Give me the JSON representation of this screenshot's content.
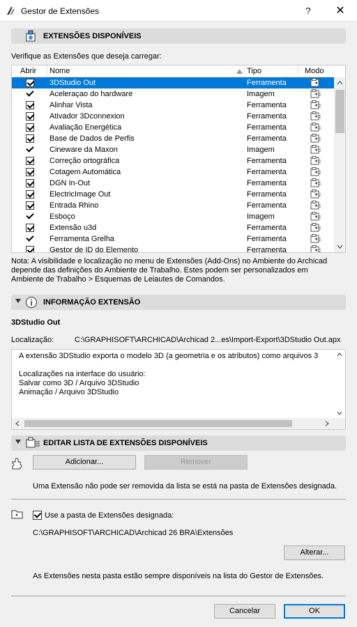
{
  "window": {
    "title": "Gestor de Extensões",
    "help": "?",
    "close": "✕"
  },
  "available": {
    "header": "EXTENSÕES DISPONÍVEIS",
    "instruction": "Verifique as Extensões que deseja carregar:",
    "columns": {
      "open": "Abrir",
      "name": "Nome",
      "type": "Tipo",
      "mode": "Modo"
    },
    "items": [
      {
        "name": "3DStudio Out",
        "type": "Ferramenta",
        "check": "box",
        "selected": true
      },
      {
        "name": "Aceleraçao do hardware",
        "type": "Imagem",
        "check": "tick"
      },
      {
        "name": "Alinhar Vista",
        "type": "Ferramenta",
        "check": "box"
      },
      {
        "name": "Ativador 3Dconnexion",
        "type": "Ferramenta",
        "check": "box"
      },
      {
        "name": "Avaliação Energética",
        "type": "Ferramenta",
        "check": "box"
      },
      {
        "name": "Base de Dados de Perfis",
        "type": "Ferramenta",
        "check": "box"
      },
      {
        "name": "Cineware da Maxon",
        "type": "Imagem",
        "check": "tick"
      },
      {
        "name": "Correção ortográfica",
        "type": "Ferramenta",
        "check": "box"
      },
      {
        "name": "Cotagem Automática",
        "type": "Ferramenta",
        "check": "box"
      },
      {
        "name": "DGN In-Out",
        "type": "Ferramenta",
        "check": "box"
      },
      {
        "name": "ElectricImage Out",
        "type": "Ferramenta",
        "check": "box"
      },
      {
        "name": "Entrada Rhino",
        "type": "Ferramenta",
        "check": "box"
      },
      {
        "name": "Esboço",
        "type": "Imagem",
        "check": "tick"
      },
      {
        "name": "Extensão u3d",
        "type": "Ferramenta",
        "check": "box"
      },
      {
        "name": "Ferramenta Grelha",
        "type": "Ferramenta",
        "check": "tick"
      },
      {
        "name": "Gestor de ID do Elemento",
        "type": "Ferramenta",
        "check": "box"
      }
    ],
    "note_lines": [
      "Nota: A visibilidade e localização no menu de Extensões (Add-Ons) no Ambiente do Archicad",
      "depende das definições do Ambiente de Trabalho. Estes podem ser personalizados em",
      "Ambiente de Trabalho > Esquemas de Leiautes de Comandos."
    ]
  },
  "info": {
    "header": "INFORMAÇÃO EXTENSÃO",
    "name": "3DStudio Out",
    "location_label": "Localização:",
    "location_value": "C:\\GRAPHISOFT\\ARCHICAD\\Archicad 2...es\\Import-Export\\3DStudio Out.apx",
    "description_lines": [
      "A extensão 3DStudio exporta o modelo 3D (a geometria e os atributos) como arquivos 3",
      "",
      "Localizações na interface do usuário:",
      "Salvar como 3D / Arquivo 3DStudio",
      "Animação / Arquivo 3DStudio"
    ]
  },
  "edit": {
    "header": "EDITAR LISTA DE EXTENSÕES DISPONÍVEIS",
    "add_label": "Adicionar...",
    "remove_label": "Remover",
    "remove_note": "Uma Extensão não pode ser removida da lista se está na pasta de Extensões designada.",
    "use_folder_label": "Use a pasta de Extensões designada:",
    "folder_path": "C:\\GRAPHISOFT\\ARCHICAD\\Archicad 26 BRA\\Extensões",
    "change_label": "Alterar...",
    "folder_note": "As Extensões nesta pasta estão sempre disponíveis na lista do Gestor de Extensões."
  },
  "footer": {
    "cancel_label": "Cancelar",
    "ok_label": "OK"
  }
}
